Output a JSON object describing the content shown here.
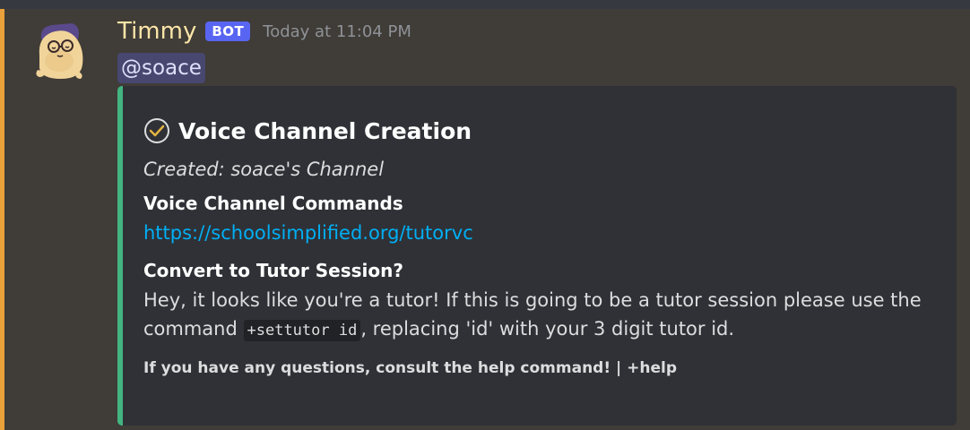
{
  "message": {
    "username": "Timmy",
    "badge": "BOT",
    "timestamp": "Today at 11:04 PM",
    "mention": "@soace"
  },
  "embed": {
    "title": "Voice Channel Creation",
    "description": "Created: soace's Channel",
    "fields": [
      {
        "name": "Voice Channel Commands",
        "value": "https://schoolsimplified.org/tutorvc"
      },
      {
        "name": "Convert to Tutor Session?",
        "value_part1": "Hey, it looks like you're a tutor! If this is going to be a tutor session please use the command ",
        "code": "+settutor id",
        "value_part2": ", replacing 'id' with your 3 digit tutor id."
      }
    ],
    "footer": "If you have any questions, consult the help command! | +help"
  },
  "colors": {
    "embed_accent": "#43b581",
    "highlight_accent": "#e9a23b",
    "badge": "#5865f2",
    "link": "#00aff4"
  },
  "icons": {
    "title_icon": "check-circle-icon",
    "avatar": "avatar"
  }
}
